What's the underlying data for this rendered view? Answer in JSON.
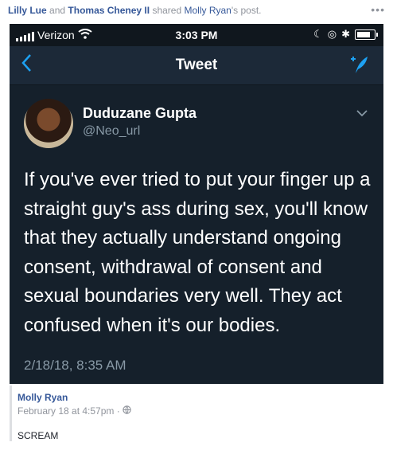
{
  "header": {
    "user1": "Lilly Lue",
    "and": "and",
    "user2": "Thomas Cheney II",
    "shared": "shared",
    "owner": "Molly Ryan",
    "suffix": "'s post.",
    "more": "•••"
  },
  "status": {
    "carrier": "Verizon",
    "time": "3:03 PM",
    "icons": [
      "wifi-icon",
      "moon-icon",
      "lock-rotation-icon",
      "bluetooth-icon",
      "battery-icon"
    ]
  },
  "nav": {
    "back": "<",
    "title": "Tweet",
    "compose_icon": "compose-tweet-icon"
  },
  "tweet": {
    "author": "Duduzane Gupta",
    "handle": "@Neo_url",
    "text": "If you've ever tried to put your finger up a straight guy's ass during sex, you'll know that they actually understand ongoing consent, withdrawal of consent and sexual boundaries very well. They act confused when it's our bodies.",
    "date": "2/18/18, 8:35 AM"
  },
  "post": {
    "author": "Molly Ryan",
    "time": "February 18 at 4:57pm",
    "separator": "·",
    "privacy_icon": "globe-icon",
    "text": "SCREAM"
  }
}
